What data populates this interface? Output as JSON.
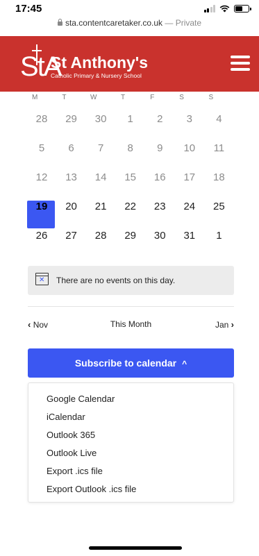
{
  "status_bar": {
    "time": "17:45"
  },
  "url_bar": {
    "domain": "sta.contentcaretaker.co.uk",
    "suffix": " — Private"
  },
  "header": {
    "logo_mark": "StA",
    "title": "St Anthony's",
    "subtitle": "Catholic Primary & Nursery School",
    "brand_color": "#c9322d"
  },
  "calendar": {
    "weekdays": [
      "M",
      "T",
      "W",
      "T",
      "F",
      "S",
      "S"
    ],
    "weeks": [
      [
        "28",
        "29",
        "30",
        "1",
        "2",
        "3",
        "4"
      ],
      [
        "5",
        "6",
        "7",
        "8",
        "9",
        "10",
        "11"
      ],
      [
        "12",
        "13",
        "14",
        "15",
        "16",
        "17",
        "18"
      ],
      [
        "19",
        "20",
        "21",
        "22",
        "23",
        "24",
        "25"
      ],
      [
        "26",
        "27",
        "28",
        "29",
        "30",
        "31",
        "1"
      ]
    ],
    "today": "19",
    "accent_color": "#3b57f2"
  },
  "no_events": {
    "message": "There are no events on this day."
  },
  "month_nav": {
    "prev": "Nov",
    "current": "This Month",
    "next": "Jan"
  },
  "subscribe": {
    "label": "Subscribe to calendar",
    "options": [
      "Google Calendar",
      "iCalendar",
      "Outlook 365",
      "Outlook Live",
      "Export .ics file",
      "Export Outlook .ics file"
    ]
  }
}
